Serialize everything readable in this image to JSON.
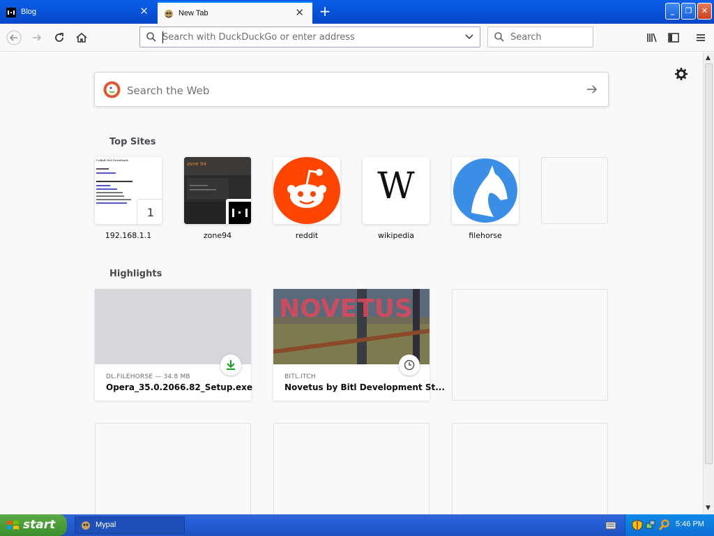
{
  "tabs": [
    {
      "title": "Blog"
    },
    {
      "title": "New Tab"
    }
  ],
  "urlbar": {
    "placeholder": "Search with DuckDuckGo or enter address"
  },
  "searchbar": {
    "placeholder": "Search"
  },
  "newtab": {
    "search_placeholder": "Search the Web",
    "top_sites_title": "Top Sites",
    "top_sites": [
      {
        "label": "192.168.1.1",
        "badge": "1"
      },
      {
        "label": "zone94"
      },
      {
        "label": "reddit"
      },
      {
        "label": "wikipedia",
        "logo_text": "W"
      },
      {
        "label": "filehorse"
      }
    ],
    "highlights_title": "Highlights",
    "highlights": [
      {
        "source": "DL.FILEHORSE — 34.8 MB",
        "title": "Opera_35.0.2066.82_Setup.exe",
        "type": "download"
      },
      {
        "source": "BITL.ITCH",
        "title": "Novetus by Bitl Development St...",
        "type": "visited",
        "thumb_text": "NOVETUS"
      }
    ],
    "site_thumb_text": {
      "zone": "zone 94",
      "lan": "CoBalt Net Downloads"
    }
  },
  "taskbar": {
    "start_label": "start",
    "task_label": "Mypal",
    "clock": "5:46 PM"
  },
  "colors": {
    "xp_blue": "#0a5ee8",
    "reddit": "#ff4500",
    "filehorse": "#3a8ee6",
    "firefox_accent": "#0a84ff"
  }
}
